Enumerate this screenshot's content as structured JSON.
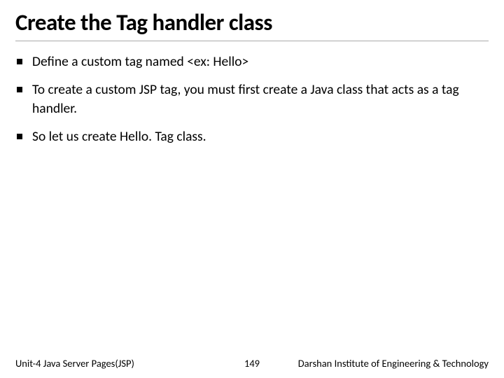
{
  "slide": {
    "title": "Create the Tag handler class",
    "bullets": [
      "Define a custom tag named <ex: Hello>",
      "To create a custom JSP tag, you must first create a Java class that acts as a tag handler.",
      "So let us create Hello. Tag class."
    ]
  },
  "footer": {
    "left": "Unit-4 Java Server Pages(JSP)",
    "center": "149",
    "right": "Darshan Institute of Engineering & Technology"
  }
}
